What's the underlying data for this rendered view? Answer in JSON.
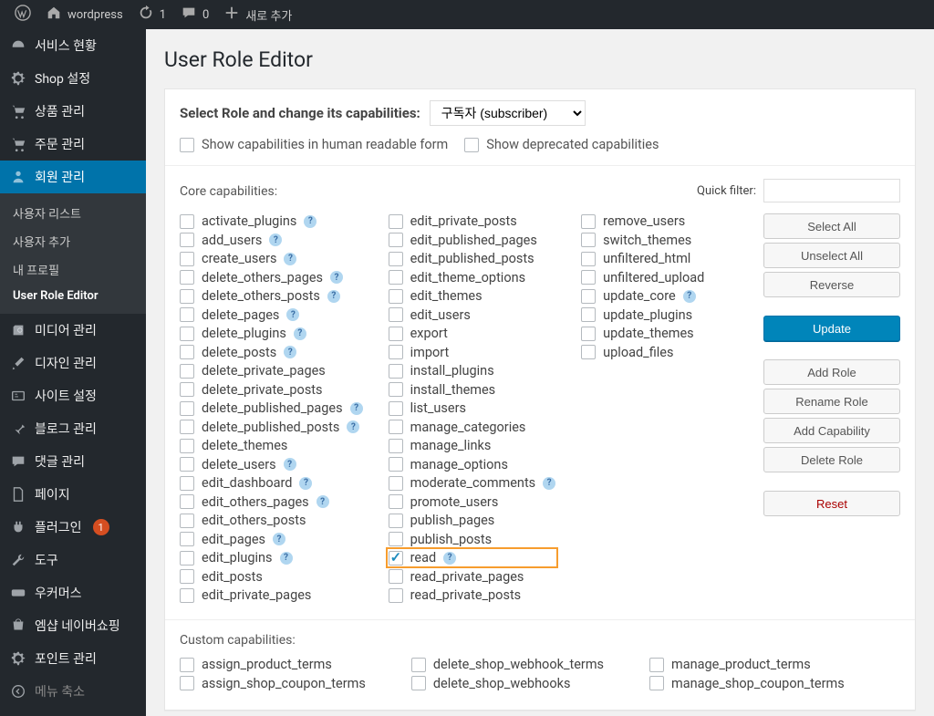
{
  "adminbar": {
    "site_name": "wordpress",
    "updates": "1",
    "comments": "0",
    "new": "새로 추가"
  },
  "sidebar": {
    "items": [
      {
        "icon": "dashboard",
        "label": "서비스 현황"
      },
      {
        "icon": "gear",
        "label": "Shop 설정"
      },
      {
        "icon": "cart",
        "label": "상품 관리"
      },
      {
        "icon": "cart",
        "label": "주문 관리"
      },
      {
        "icon": "user",
        "label": "회원 관리",
        "active": true
      },
      {
        "icon": "media",
        "label": "미디어 관리"
      },
      {
        "icon": "brush",
        "label": "디자인 관리"
      },
      {
        "icon": "admin",
        "label": "사이트 설정"
      },
      {
        "icon": "pin",
        "label": "블로그 관리"
      },
      {
        "icon": "comment",
        "label": "댓글 관리"
      },
      {
        "icon": "page",
        "label": "페이지"
      },
      {
        "icon": "plugin",
        "label": "플러그인",
        "badge": "1"
      },
      {
        "icon": "tool",
        "label": "도구"
      },
      {
        "icon": "woo",
        "label": "우커머스"
      },
      {
        "icon": "mshop",
        "label": "엠샵 네이버쇼핑"
      },
      {
        "icon": "gear",
        "label": "포인트 관리"
      },
      {
        "icon": "collapse",
        "label": "메뉴 축소"
      }
    ],
    "submenu": {
      "items": [
        {
          "label": "사용자 리스트"
        },
        {
          "label": "사용자 추가"
        },
        {
          "label": "내 프로필"
        },
        {
          "label": "User Role Editor",
          "current": true
        }
      ]
    }
  },
  "page": {
    "title": "User Role Editor",
    "select_role_label": "Select Role and change its capabilities:",
    "role_selected": "구독자 (subscriber)",
    "flag_human": "Show capabilities in human readable form",
    "flag_deprecated": "Show deprecated capabilities",
    "core_label": "Core capabilities:",
    "quick_filter_label": "Quick filter:",
    "custom_label": "Custom capabilities:"
  },
  "buttons": {
    "select_all": "Select All",
    "unselect_all": "Unselect All",
    "reverse": "Reverse",
    "update": "Update",
    "add_role": "Add Role",
    "rename_role": "Rename Role",
    "add_capability": "Add Capability",
    "delete_role": "Delete Role",
    "reset": "Reset"
  },
  "caps_col1": [
    {
      "name": "activate_plugins",
      "help": true
    },
    {
      "name": "add_users",
      "help": true
    },
    {
      "name": "create_users",
      "help": true
    },
    {
      "name": "delete_others_pages",
      "help": true
    },
    {
      "name": "delete_others_posts",
      "help": true
    },
    {
      "name": "delete_pages",
      "help": true
    },
    {
      "name": "delete_plugins",
      "help": true
    },
    {
      "name": "delete_posts",
      "help": true
    },
    {
      "name": "delete_private_pages"
    },
    {
      "name": "delete_private_posts"
    },
    {
      "name": "delete_published_pages",
      "help": true
    },
    {
      "name": "delete_published_posts",
      "help": true
    },
    {
      "name": "delete_themes"
    },
    {
      "name": "delete_users",
      "help": true
    },
    {
      "name": "edit_dashboard",
      "help": true
    },
    {
      "name": "edit_others_pages",
      "help": true
    },
    {
      "name": "edit_others_posts"
    },
    {
      "name": "edit_pages",
      "help": true
    },
    {
      "name": "edit_plugins",
      "help": true
    },
    {
      "name": "edit_posts"
    },
    {
      "name": "edit_private_pages"
    }
  ],
  "caps_col2": [
    {
      "name": "edit_private_posts"
    },
    {
      "name": "edit_published_pages"
    },
    {
      "name": "edit_published_posts"
    },
    {
      "name": "edit_theme_options"
    },
    {
      "name": "edit_themes"
    },
    {
      "name": "edit_users"
    },
    {
      "name": "export"
    },
    {
      "name": "import"
    },
    {
      "name": "install_plugins"
    },
    {
      "name": "install_themes"
    },
    {
      "name": "list_users"
    },
    {
      "name": "manage_categories"
    },
    {
      "name": "manage_links"
    },
    {
      "name": "manage_options"
    },
    {
      "name": "moderate_comments",
      "help": true
    },
    {
      "name": "promote_users"
    },
    {
      "name": "publish_pages"
    },
    {
      "name": "publish_posts"
    },
    {
      "name": "read",
      "help": true,
      "checked": true,
      "highlighted": true
    },
    {
      "name": "read_private_pages"
    },
    {
      "name": "read_private_posts"
    }
  ],
  "caps_col3": [
    {
      "name": "remove_users"
    },
    {
      "name": "switch_themes"
    },
    {
      "name": "unfiltered_html"
    },
    {
      "name": "unfiltered_upload"
    },
    {
      "name": "update_core",
      "help": true
    },
    {
      "name": "update_plugins"
    },
    {
      "name": "update_themes"
    },
    {
      "name": "upload_files"
    }
  ],
  "custom_col1": [
    "assign_product_terms",
    "assign_shop_coupon_terms"
  ],
  "custom_col2": [
    "delete_shop_webhook_terms",
    "delete_shop_webhooks"
  ],
  "custom_col3": [
    "manage_product_terms",
    "manage_shop_coupon_terms"
  ]
}
